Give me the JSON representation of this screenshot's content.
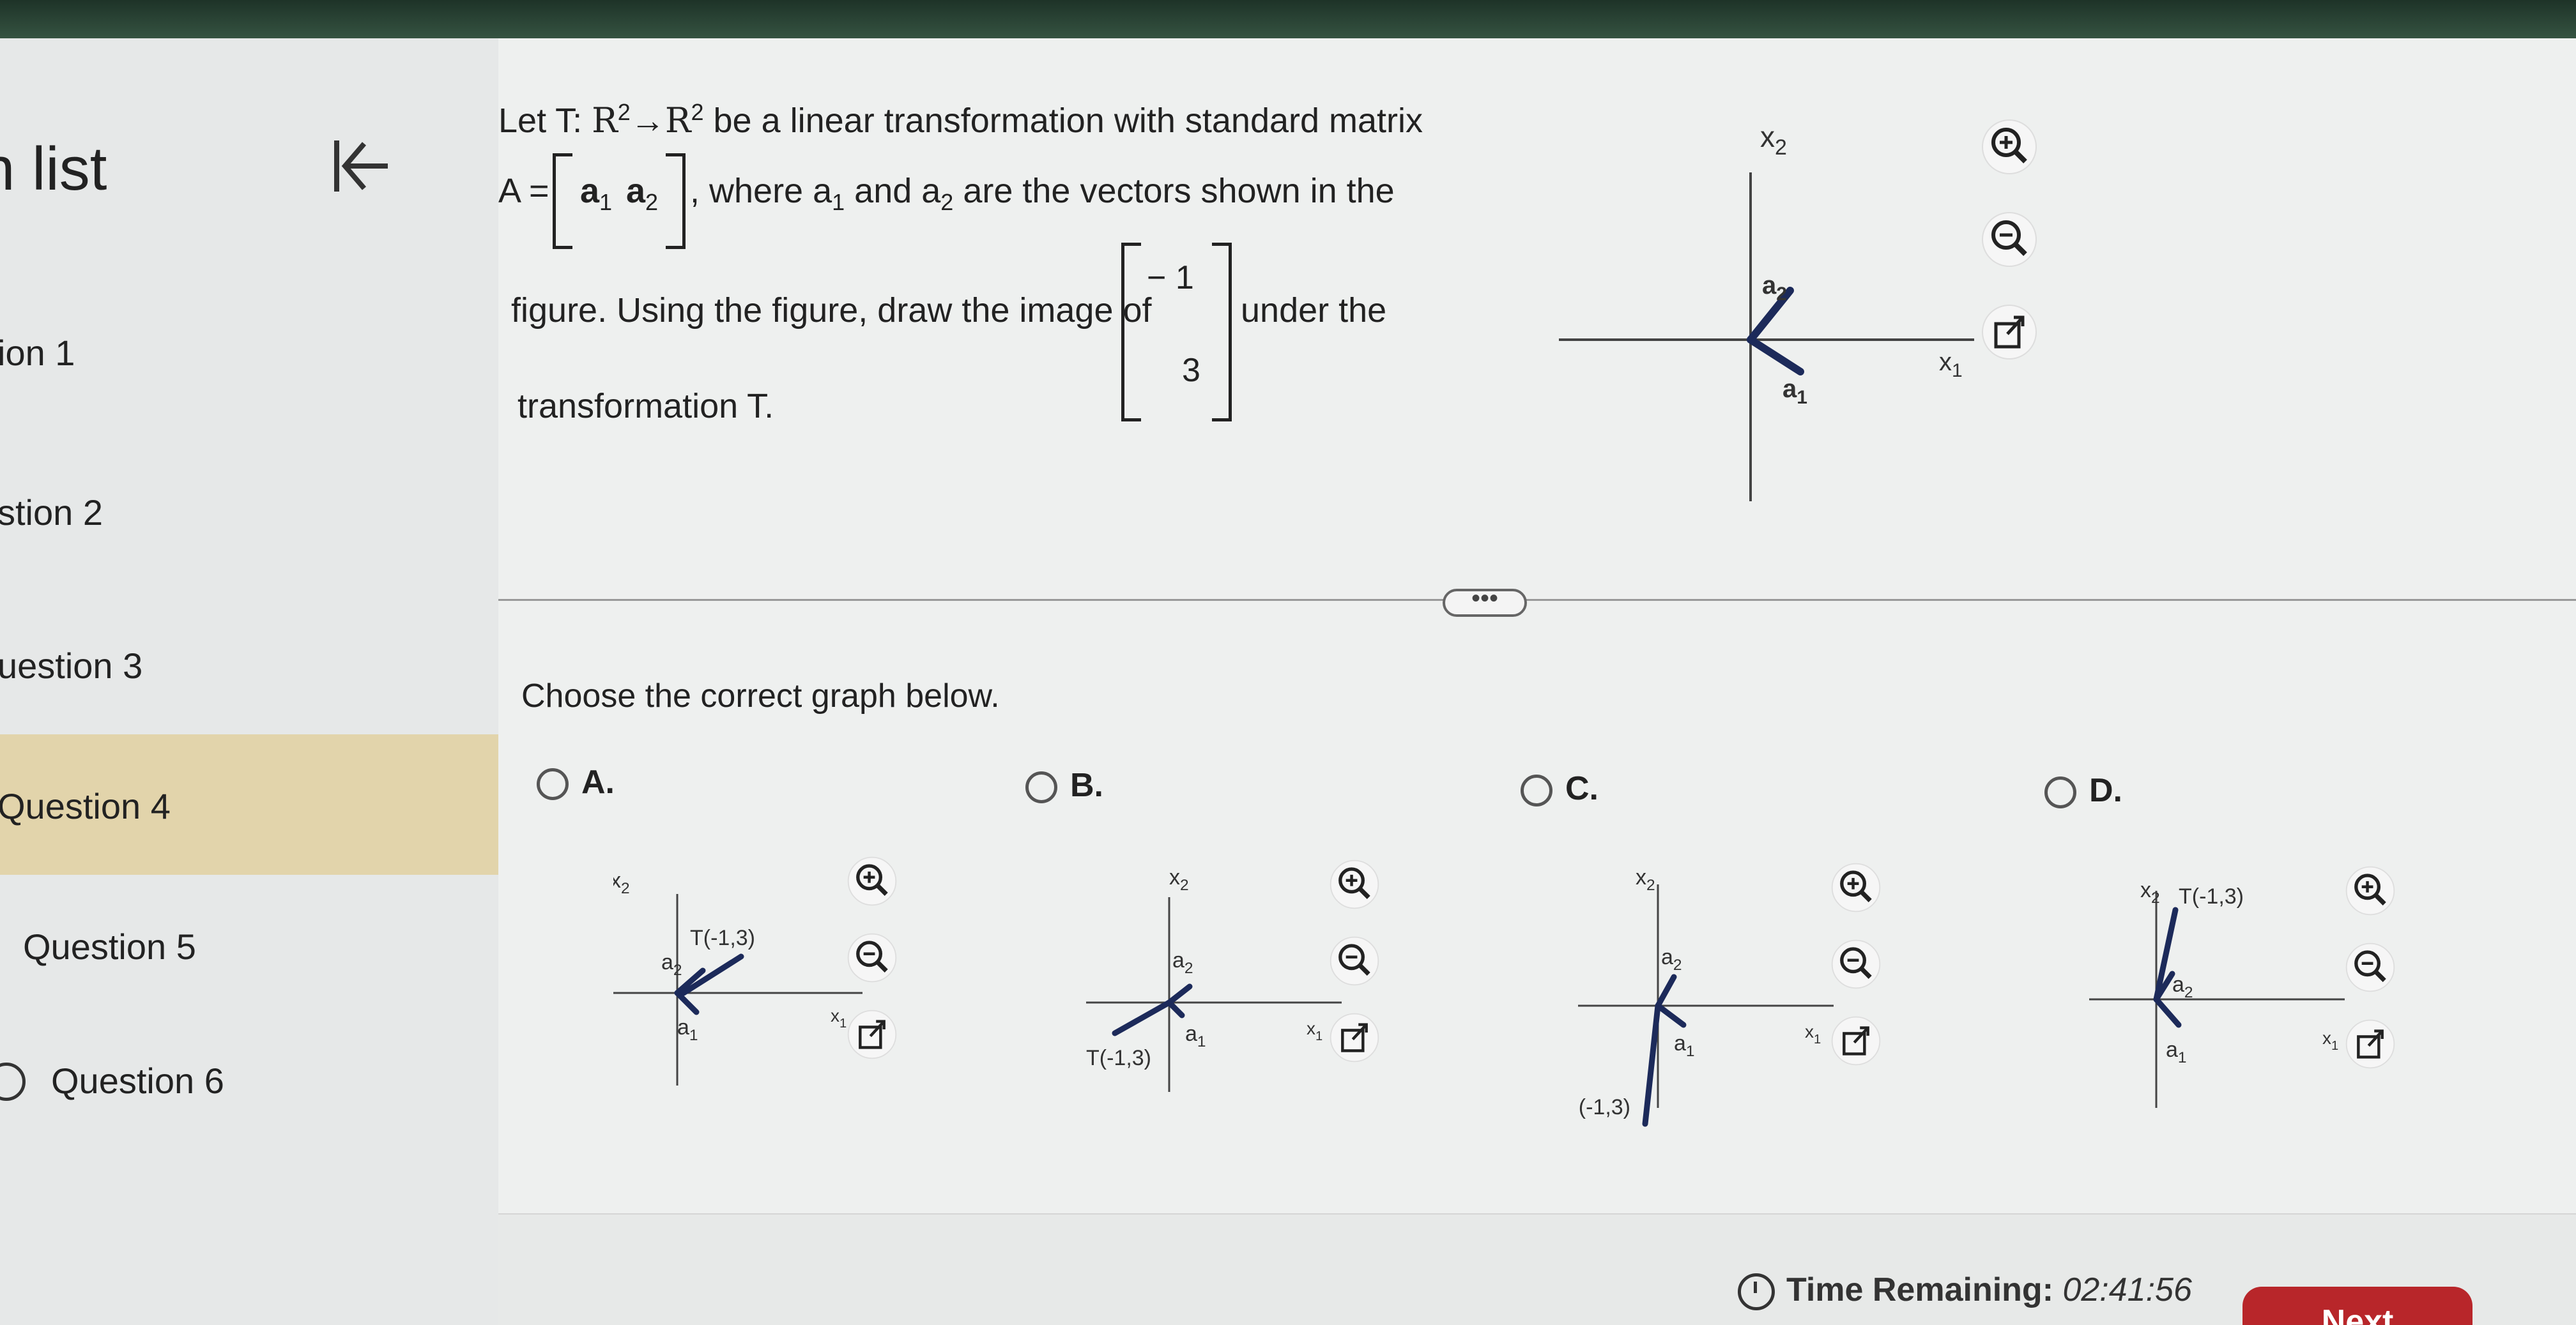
{
  "sidebar": {
    "title": "n list",
    "items": [
      {
        "label": "ion 1"
      },
      {
        "label": "stion 2"
      },
      {
        "label": "uestion 3"
      },
      {
        "label": "Question 4"
      },
      {
        "label": "Question 5"
      },
      {
        "label": "Question 6"
      }
    ]
  },
  "question": {
    "line1_prefix": "Let T: ",
    "line1_domain": "R",
    "line1_exp": "2",
    "line1_arrow": "→",
    "line1_codomain": "R",
    "line1_exp2": "2",
    "line1_suffix": " be a linear transformation with standard matrix",
    "matrix_prefix": "A =",
    "matrix_col1": "a",
    "matrix_col1_sub": "1",
    "matrix_col2": "a",
    "matrix_col2_sub": "2",
    "line2_suffix": ", where a",
    "line2_sub1": "1",
    "line2_and": " and a",
    "line2_sub2": "2",
    "line2_end": " are the vectors shown in the",
    "line3_prefix": "figure. Using the figure, draw the image of",
    "vec_top": "− 1",
    "vec_bottom": "3",
    "line3_suffix": "under the",
    "line4": "transformation T.",
    "choose": "Choose the correct graph below."
  },
  "figure_labels": {
    "x1": "x",
    "x1_sub": "1",
    "x2": "x",
    "x2_sub": "2",
    "a1": "a",
    "a1_sub": "1",
    "a2": "a",
    "a2_sub": "2",
    "t_label": "T(-1,3)"
  },
  "options": [
    {
      "letter": "A."
    },
    {
      "letter": "B."
    },
    {
      "letter": "C."
    },
    {
      "letter": "D."
    }
  ],
  "footer": {
    "time_label": "Time Remaining:",
    "time_value": "02:41:56",
    "next_label": "Next"
  },
  "colors": {
    "vector": "#1c2a5a",
    "active_item": "#e2d4ab",
    "next_button": "#b8262a"
  }
}
